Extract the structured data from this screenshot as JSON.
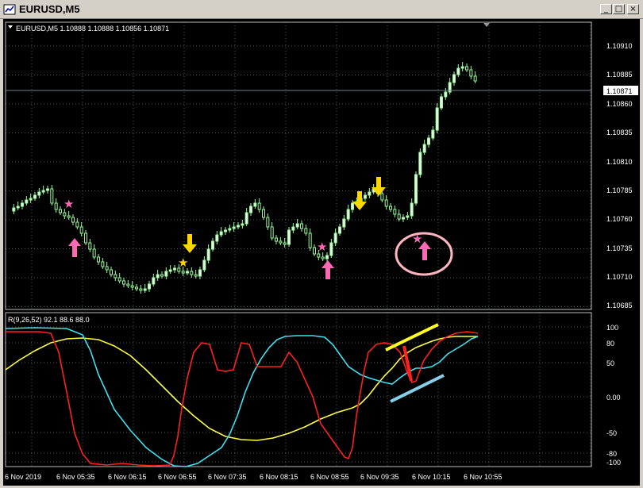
{
  "window": {
    "title": "EURUSD,M5",
    "buttons": [
      "_",
      "□",
      "×"
    ]
  },
  "main": {
    "symbol_line": "EURUSD,M5  1.10888 1.10888 1.10856 1.10871",
    "price_levels": [
      "1.10910",
      "1.10885",
      "1.10860",
      "1.10835",
      "1.10810",
      "1.10785",
      "1.10760",
      "1.10735",
      "1.10710",
      "1.10685"
    ],
    "current_price": "1.10871"
  },
  "indicator": {
    "label": "R(9,26,52) 92.1 88.6 88.0",
    "levels": [
      "100",
      "80",
      "50",
      "0.00",
      "-50",
      "-80",
      "-100"
    ]
  },
  "time_axis": [
    "6 Nov 2019",
    "6 Nov 05:35",
    "6 Nov 06:15",
    "6 Nov 06:55",
    "6 Nov 07:35",
    "6 Nov 08:15",
    "6 Nov 08:55",
    "6 Nov 09:35",
    "6 Nov 10:15",
    "6 Nov 10:55"
  ],
  "colors": {
    "background": "#000000",
    "candle": "#98fb98",
    "red": "#ff0000",
    "cyan": "#40e0f0",
    "yellow": "#ffff40",
    "pink": "#ff69b4"
  }
}
